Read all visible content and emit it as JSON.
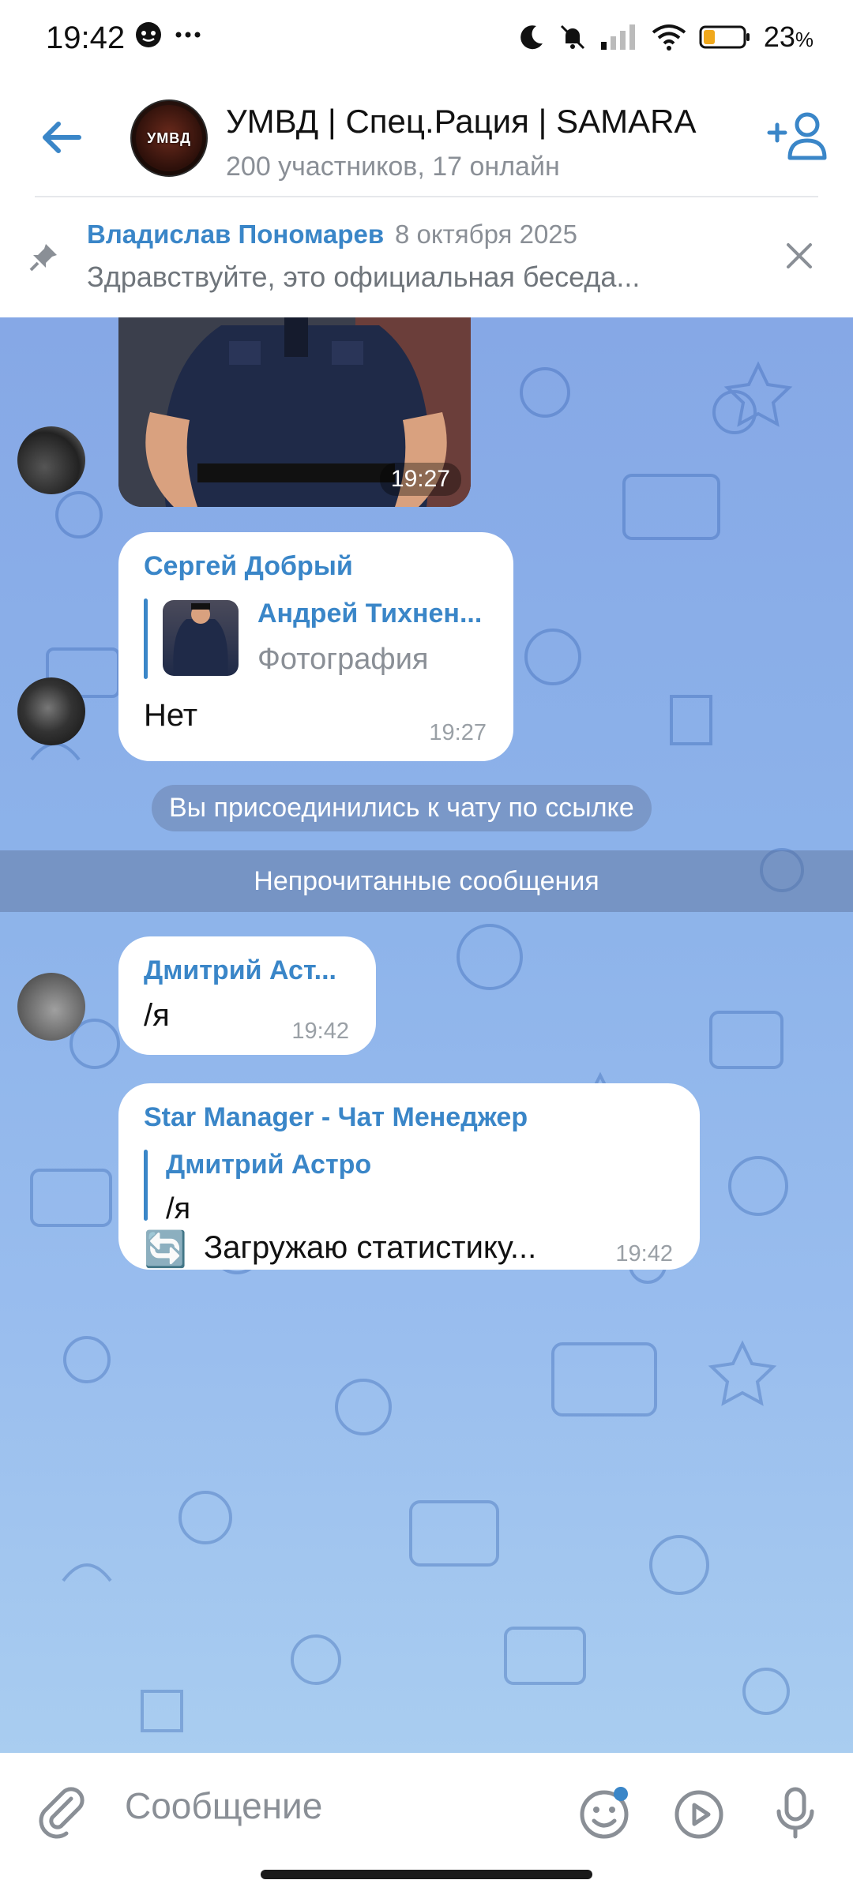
{
  "status_bar": {
    "time": "19:42",
    "left_icons": [
      "chat-bubble-icon",
      "more-icon"
    ],
    "right_icons": [
      "moon-icon",
      "mute-icon",
      "signal-icon",
      "wifi-icon",
      "battery-icon"
    ],
    "battery": "23",
    "battery_unit": "%"
  },
  "header": {
    "title": "УМВД | Спец.Рация | SAMARA",
    "subtitle": "200 участников, 17 онлайн",
    "avatar_logo": "УМВД"
  },
  "pinned": {
    "author": "Владислав Пономарев",
    "date": "8 октября 2025",
    "text": "Здравствуйте, это официальная беседа..."
  },
  "messages": {
    "photo_time": "19:27",
    "sergey": {
      "sender": "Сергей Добрый",
      "reply_author": "Андрей Тихнен...",
      "reply_text": "Фотография",
      "text": "Нет",
      "time": "19:27"
    },
    "service_joined": "Вы присоединились к чату по ссылке",
    "unread_label": "Непрочитанные сообщения",
    "dmitry": {
      "sender": "Дмитрий Аст...",
      "text": "/я",
      "time": "19:42"
    },
    "bot": {
      "sender": "Star Manager - Чат Менеджер",
      "reply_author": "Дмитрий Астро",
      "reply_text": "/я",
      "emoji": "🔄",
      "text": "Загружаю статистику...",
      "time": "19:42"
    }
  },
  "input": {
    "placeholder": "Сообщение"
  },
  "colors": {
    "accent": "#3a86c8",
    "chat_bg_top": "#86a8e6",
    "chat_bg_bottom": "#a9cdf0"
  }
}
